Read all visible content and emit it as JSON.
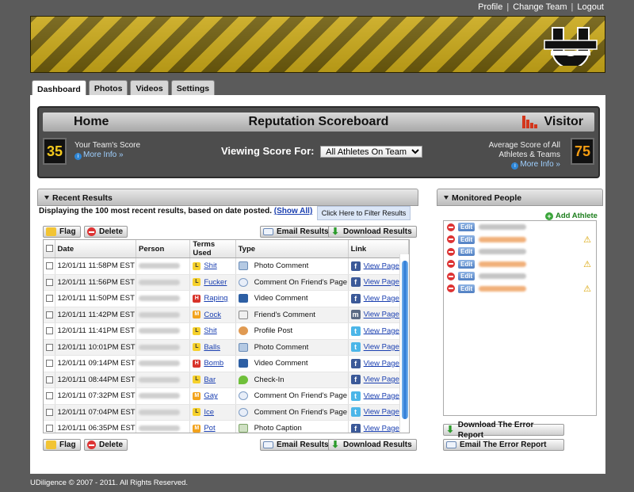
{
  "topnav": {
    "profile": "Profile",
    "change_team": "Change Team",
    "logout": "Logout"
  },
  "tabs": [
    {
      "label": "Dashboard",
      "active": true
    },
    {
      "label": "Photos",
      "active": false
    },
    {
      "label": "Videos",
      "active": false
    },
    {
      "label": "Settings",
      "active": false
    }
  ],
  "scoreboard": {
    "title": "Reputation Scoreboard",
    "home": "Home",
    "visitor": "Visitor",
    "home_score": "35",
    "visitor_score": "75",
    "home_label": "Your Team's Score",
    "visitor_label": "Average Score of All Athletes & Teams",
    "more_info": "More Info »",
    "viewing_label": "Viewing Score For:",
    "viewing_selected": "All Athletes On Team"
  },
  "recent": {
    "title": "Recent Results",
    "display_text": "Displaying the 100 most recent results, based on date posted.",
    "show_all": "(Show All)",
    "filter": "Click Here to Filter Results",
    "flag": "Flag",
    "delete": "Delete",
    "email": "Email Results",
    "download": "Download Results",
    "columns": [
      "Date",
      "Person",
      "Terms Used",
      "Type",
      "Link"
    ],
    "rows": [
      {
        "date": "12/01/11 11:58PM EST",
        "level": "L",
        "term": "Shit",
        "type": "Photo Comment",
        "type_icon": "photo-comment-icon",
        "net": "fb",
        "link": "View Page"
      },
      {
        "date": "12/01/11 11:56PM EST",
        "level": "L",
        "term": "Fucker",
        "type": "Comment On Friend's Page",
        "type_icon": "comment-bubble-icon",
        "net": "fb",
        "link": "View Page"
      },
      {
        "date": "12/01/11 11:50PM EST",
        "level": "H",
        "term": "Raping",
        "type": "Video Comment",
        "type_icon": "video-icon",
        "net": "fb",
        "link": "View Page"
      },
      {
        "date": "12/01/11 11:42PM EST",
        "level": "M",
        "term": "Cock",
        "type": "Friend's Comment",
        "type_icon": "friend-comment-icon",
        "net": "ms",
        "link": "View Page"
      },
      {
        "date": "12/01/11 11:41PM EST",
        "level": "L",
        "term": "Shit",
        "type": "Profile Post",
        "type_icon": "profile-icon",
        "net": "tw",
        "link": "View Page"
      },
      {
        "date": "12/01/11 10:01PM EST",
        "level": "L",
        "term": "Balls",
        "type": "Photo Comment",
        "type_icon": "photo-comment-icon",
        "net": "tw",
        "link": "View Page"
      },
      {
        "date": "12/01/11 09:14PM EST",
        "level": "H",
        "term": "Bomb",
        "type": "Video Comment",
        "type_icon": "video-icon",
        "net": "fb",
        "link": "View Page"
      },
      {
        "date": "12/01/11 08:44PM EST",
        "level": "L",
        "term": "Bar",
        "type": "Check-In",
        "type_icon": "check-in-icon",
        "net": "fb",
        "link": "View Page"
      },
      {
        "date": "12/01/11 07:32PM EST",
        "level": "M",
        "term": "Gay",
        "type": "Comment On Friend's Page",
        "type_icon": "comment-bubble-icon",
        "net": "tw",
        "link": "View Page"
      },
      {
        "date": "12/01/11 07:04PM EST",
        "level": "L",
        "term": "Ice",
        "type": "Comment On Friend's Page",
        "type_icon": "comment-bubble-icon",
        "net": "tw",
        "link": "View Page"
      },
      {
        "date": "12/01/11 06:35PM EST",
        "level": "M",
        "term": "Pot",
        "type": "Photo Caption",
        "type_icon": "photo-caption-icon",
        "net": "fb",
        "link": "View Page"
      }
    ]
  },
  "monitored": {
    "title": "Monitored People",
    "add": "Add Athlete",
    "edit": "Edit",
    "people": [
      {
        "color": "g",
        "warn": false
      },
      {
        "color": "o",
        "warn": true
      },
      {
        "color": "g",
        "warn": false
      },
      {
        "color": "o",
        "warn": true
      },
      {
        "color": "g",
        "warn": false
      },
      {
        "color": "o",
        "warn": true
      }
    ],
    "download_error": "Download The Error Report",
    "email_error": "Email The Error Report"
  },
  "footer": "UDiligence © 2007 - 2011. All Rights Reserved.",
  "colors": {
    "accent_gold": "#c9a819",
    "link_blue": "#1a3fb0",
    "high": "#d8332a",
    "medium": "#f2a21b",
    "low": "#f6d12c"
  }
}
